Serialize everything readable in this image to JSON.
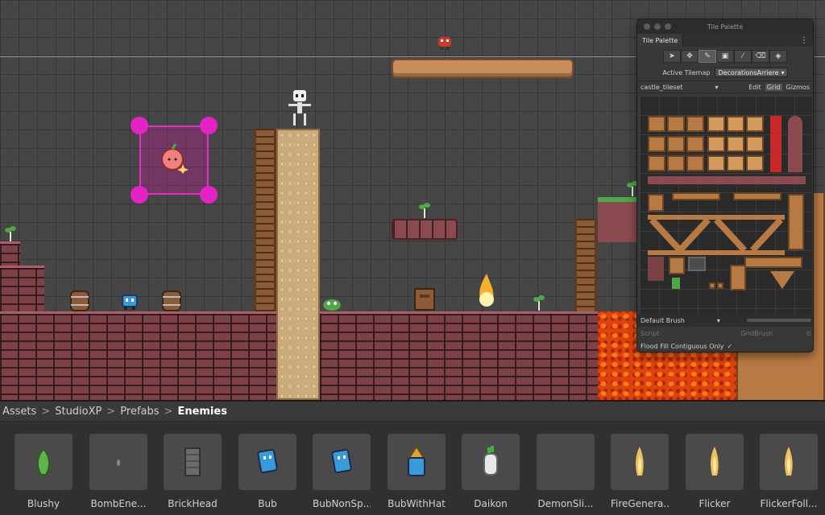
{
  "palette": {
    "window_title": "Tile Palette",
    "tab_label": "Tile Palette",
    "menu_icon": "kebab-icon",
    "tools": [
      "select-icon",
      "move-icon",
      "paint-icon",
      "box-fill-icon",
      "picker-icon",
      "eraser-icon",
      "fill-icon"
    ],
    "active_tilemap_label": "Active Tilemap",
    "active_tilemap_value": "DecorationsArriere",
    "tileset_name": "castle_tileset",
    "edit_label": "Edit",
    "grid_label": "Grid",
    "gizmos_label": "Gizmos",
    "brush_name": "Default Brush",
    "script_label": "Script",
    "script_value": "GridBrush",
    "flood_fill_label": "Flood Fill Contiguous Only",
    "flood_fill_checked": "✓"
  },
  "breadcrumb": {
    "items": [
      "Assets",
      "StudioXP",
      "Prefabs"
    ],
    "current": "Enemies",
    "separator": ">"
  },
  "assets": [
    {
      "label": "Blushy",
      "icon": "blushy-sprite-icon",
      "color": "#5fb34a"
    },
    {
      "label": "BombEne...",
      "icon": "bomb-enemy-sprite-icon",
      "color": "#8a8a8a"
    },
    {
      "label": "BrickHead",
      "icon": "brickhead-sprite-icon",
      "color": "#6b6b6b"
    },
    {
      "label": "Bub",
      "icon": "bub-sprite-icon",
      "color": "#3a9ad9"
    },
    {
      "label": "BubNonSp...",
      "icon": "bub-nonspawn-sprite-icon",
      "color": "#3a9ad9"
    },
    {
      "label": "BubWithHat",
      "icon": "bub-with-hat-sprite-icon",
      "color": "#d9a23a"
    },
    {
      "label": "Daikon",
      "icon": "daikon-sprite-icon",
      "color": "#e8e8e8"
    },
    {
      "label": "DemonSli...",
      "icon": "demon-slime-sprite-icon",
      "color": "#4a4a4a"
    },
    {
      "label": "FireGenera...",
      "icon": "fire-generator-sprite-icon",
      "color": "#f0c060"
    },
    {
      "label": "Flicker",
      "icon": "flicker-sprite-icon",
      "color": "#f0c060"
    },
    {
      "label": "FlickerFoll...",
      "icon": "flicker-follow-sprite-icon",
      "color": "#f0c060"
    }
  ]
}
